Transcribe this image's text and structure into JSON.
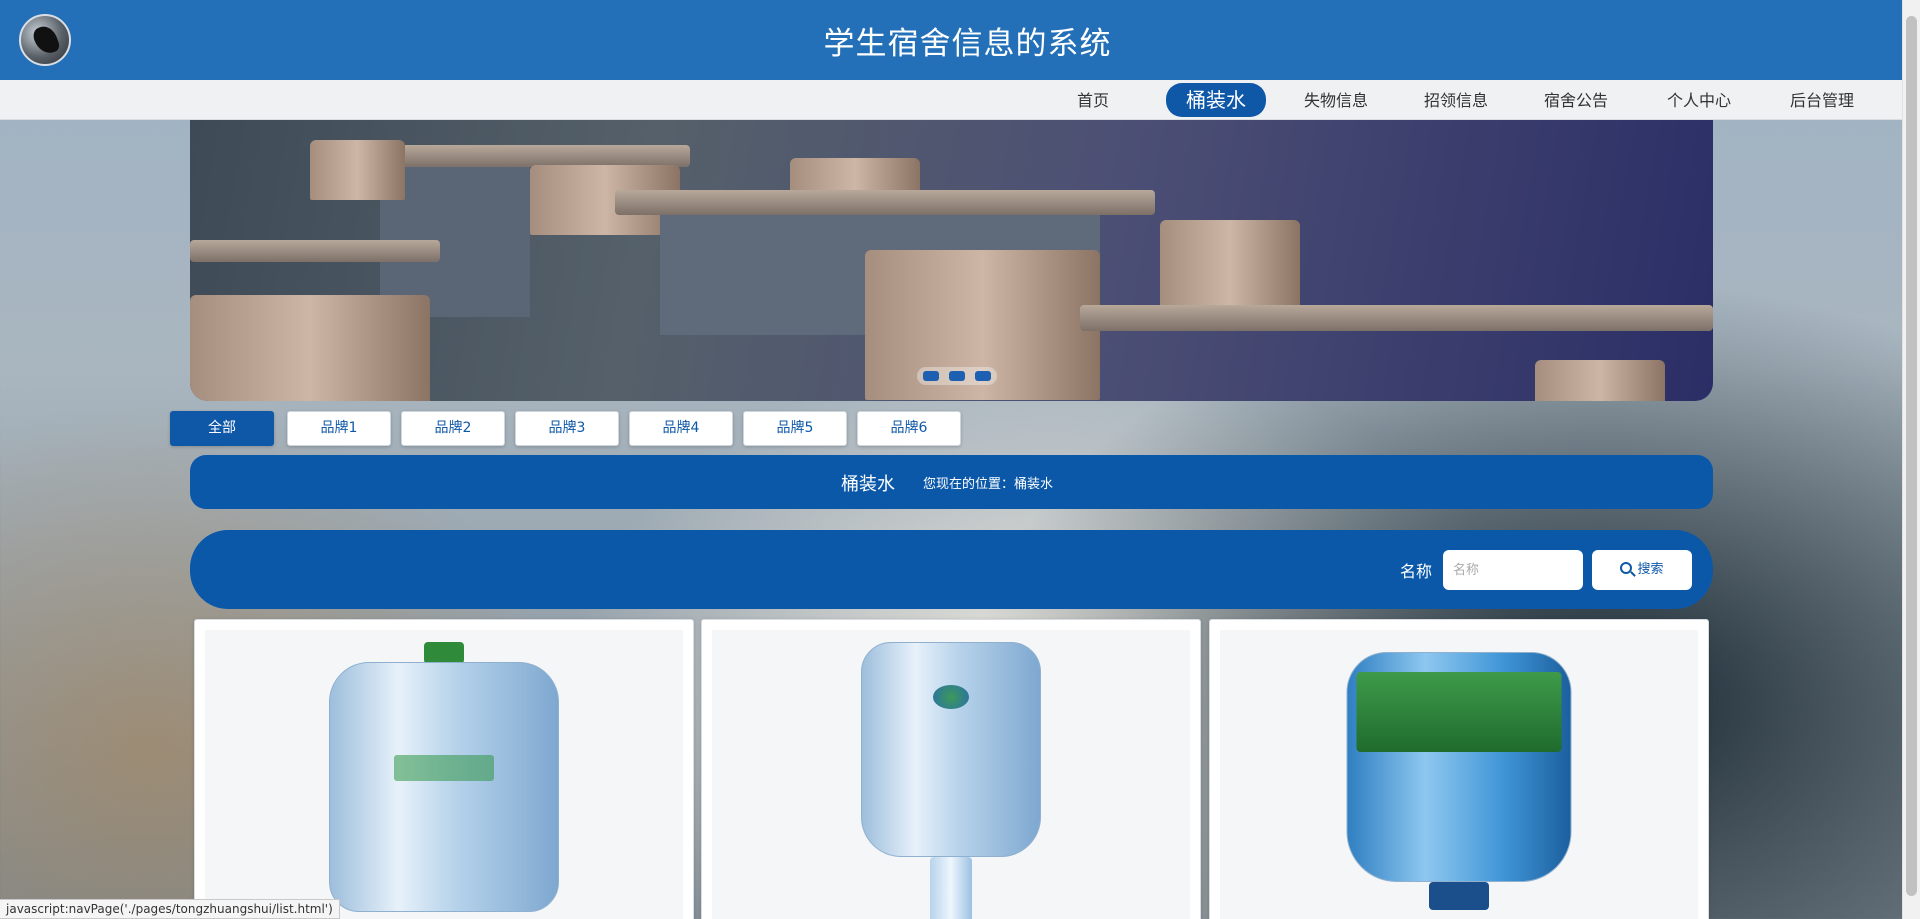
{
  "header": {
    "title": "学生宿舍信息的系统"
  },
  "nav": {
    "items": [
      {
        "label": "首页"
      },
      {
        "label": "桶装水"
      },
      {
        "label": "失物信息"
      },
      {
        "label": "招领信息"
      },
      {
        "label": "宿舍公告"
      },
      {
        "label": "个人中心"
      },
      {
        "label": "后台管理"
      }
    ],
    "active_index": 1
  },
  "brand_filter": {
    "tabs": [
      "全部",
      "品牌1",
      "品牌2",
      "品牌3",
      "品牌4",
      "品牌5",
      "品牌6"
    ],
    "active_index": 0
  },
  "breadcrumb": {
    "title": "桶装水",
    "location_text": "您现在的位置：桶装水"
  },
  "search": {
    "label": "名称",
    "placeholder": "名称",
    "button_label": "搜索"
  },
  "status_bar": {
    "text": "javascript:navPage('./pages/tongzhuangshui/list.html')"
  },
  "colors": {
    "primary": "#0b58a9",
    "header": "#2470b8"
  }
}
